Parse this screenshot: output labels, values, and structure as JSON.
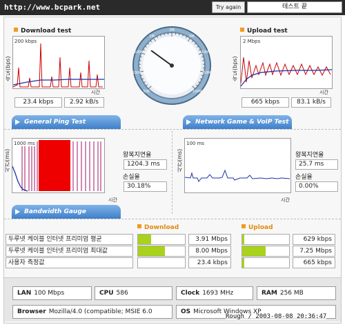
{
  "header": {
    "url": "http://www.bcpark.net",
    "try_again": "Try again",
    "status": "테스트 끝"
  },
  "download": {
    "title": "Download test",
    "y_unit": "속도(bps)",
    "y_max": "200 kbps",
    "x_label": "시간",
    "kbps": "23.4 kbps",
    "kBs": "2.92 kB/s"
  },
  "upload": {
    "title": "Upload test",
    "y_unit": "속도(bps)",
    "y_max": "2 Mbps",
    "x_label": "시간",
    "kbps": "665 kbps",
    "kBs": "83.1 kB/s"
  },
  "gauge": {
    "ticks": [
      "50K",
      "100K",
      "500K",
      "1M",
      "2M",
      "5M",
      "10M",
      "50M",
      "100M"
    ],
    "needle_level": 0.3
  },
  "tabs": {
    "ping": "General Ping Test",
    "voip": "Network Game & VoIP Test",
    "bandwidth": "Bandwidth Gauge"
  },
  "ping": {
    "y_unit": "시간(ms)",
    "y_max": "1000 ms",
    "x_label": "시간",
    "rtt_label": "왕복지연율",
    "rtt": "1204.3 ms",
    "loss_label": "손실율",
    "loss": "30.18%"
  },
  "voip": {
    "y_unit": "시간(ms)",
    "y_max": "100 ms",
    "x_label": "시간",
    "rtt_label": "왕복지연율",
    "rtt": "25.7 ms",
    "loss_label": "손실율",
    "loss": "0.00%"
  },
  "bandwidth": {
    "download_header": "Download",
    "upload_header": "Upload",
    "rows": [
      {
        "label": "두루넷 케이블 인터넷 프리미엄 평균",
        "down": "3.91 Mbps",
        "down_level": 0.28,
        "up": "629 kbps",
        "up_level": 0.04
      },
      {
        "label": "두루넷 케이블 인터넷 프리미엄 최대값",
        "down": "8.00 Mbps",
        "down_level": 0.57,
        "up": "7.25 Mbps",
        "up_level": 0.5
      },
      {
        "label": "사용자 측정값",
        "down": "23.4 kbps",
        "down_level": 0.0,
        "up": "665 kbps",
        "up_level": 0.04
      }
    ]
  },
  "system": {
    "lan_label": "LAN",
    "lan": "100 Mbps",
    "cpu_label": "CPU",
    "cpu": "586",
    "clock_label": "Clock",
    "clock": "1693 MHz",
    "ram_label": "RAM",
    "ram": "256 MB",
    "browser_label": "Browser",
    "browser": "Mozilla/4.0 (compatible; MSIE 6.0",
    "os_label": "OS",
    "os": "Microsoft Windows XP"
  },
  "footer": {
    "stamp": "Rough / 2003-08-08 20:36:47"
  },
  "colors": {
    "accent_orange": "#f29a1c",
    "plot_red": "#cc0000",
    "plot_blue": "#1a2fa8",
    "gauge_green": "#a9d21c"
  }
}
